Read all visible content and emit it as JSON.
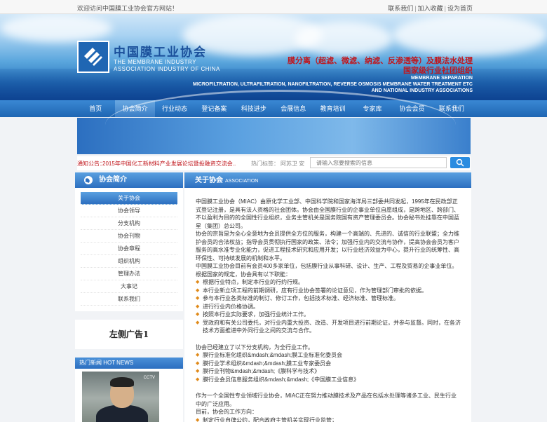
{
  "topbar": {
    "welcome": "欢迎访问中国膜工业协会官方网站！",
    "links": [
      "联系我们",
      "加入收藏",
      "设为首页"
    ]
  },
  "banner": {
    "logo_cn": "中国膜工业协会",
    "logo_en": [
      "THE MEMBRANE INDUSTRY",
      "ASSOCIATION INDUSTRY OF CHINA",
      ""
    ],
    "slogan_cn_1": "膜分离（超滤、微滤、纳滤、反渗透等）及膜法水处理",
    "slogan_cn_2": "国家级行业社团组织",
    "slogan_en_1": "MEMBRANE SEPARATION",
    "slogan_en_2": "MICROFILTRATION, ULTRAFILTRATION, NANOFILTRATION, REVERSE OSMOSIS MEMBRANE WATER TREATMENT ETC",
    "slogan_en_3": "AND NATIONAL INDUSTRY ASSOCIATIONS"
  },
  "nav": {
    "items": [
      "首页",
      "协会简介",
      "行业动态",
      "登记备案",
      "科技进步",
      "会展信息",
      "教育培训",
      "专家库",
      "协会会员",
      "联系我们"
    ],
    "active_index": 1
  },
  "notice": {
    "label": "通知公告：",
    "text": "2015年中国化工新材料产业发展论坛暨投融资交流会...",
    "hot_label": "热门标签：",
    "hot_words": "阿苏卫  安",
    "search_placeholder": "请输入您要搜索的信息"
  },
  "sidebar": {
    "title": "协会简介",
    "items": [
      "关于协会",
      "协会领导",
      "分支机构",
      "协会刊物",
      "协会章程",
      "组织机构",
      "管理办法",
      "大事记",
      "联系我们"
    ],
    "active_index": 0,
    "ad": "左侧广告1",
    "news_title": "热门新闻 HOT NEWS",
    "news_tag": "CCTV"
  },
  "content": {
    "title": "关于协会",
    "subtitle": "ASSOCIATION",
    "p1": "中国膜工业协会（MIAC）由原化学工业部、中国科学院和国家海洋局三部委共同发起，1995年在民政部正式登记注册，是具有法人资格的社会团体。协会由全国膜行业的企事业单位自愿组成，是跨地区、跨部门、不以盈利为目的的全国性行业组织，业务主管机关是国务院国有资产管理委员会。协会秘书处挂靠在中国蓝星（集团）总公司。",
    "p2": "协会的宗旨是为全心全意地为会员提供全方位的服务，构建一个高端的、先进的、诚信的行业联盟；全力维护会员的合法权益；指导会员贯彻执行国家的政策、法令；加强行业内的交流与协作，提高协会会员为客户服务的高水准专业化能力，促进工程技术研究和应用开发；以行业经济效益为中心，提升行业的统筹性、高环保性、可持续发展的机制和水平。",
    "p3": "中国膜工业协会目前有会员400多家单位，包括膜行业从事科研、设计、生产、工程及贸易的企事业单位。根据国家的规定，协会具有以下职能：",
    "bullets1": [
      "根据行业特点，制定本行业的行约行规。",
      "本行业新立项工程的前期调研，应有行业协会签署的论证意见，作为管理部门审批的依据。",
      "参与本行业各类标准的制订、修订工作，包括技术标准、经济标准、管理标准。",
      "进行行业内价格协调。",
      "按照本行业实际要求，加强行业统计工作。",
      "受政府和有关公司委托，对行业内重大投资、改造、开发项目进行前期论证，并参与监督。同时，在各济技术方面推进中外同行业之间的交流与合作。"
    ],
    "p4": "协会已经建立了以下分支机构，为全行业工作。",
    "bullets2": [
      "膜行业标准化组织&mdash;&mdash;膜工业标准化委员会",
      "膜行业学术组织&mdash;&mdash;膜工业专家委员会",
      "膜行业刊物&mdash;&mdash;《膜科学与技术》",
      "膜行业会员信息服务组织&mdash;&mdash;《中国膜工业信息》"
    ],
    "p5": "作为一个全国性专业领域行业协会，MIAC正在努力推动膜技术及产品在包括水处理等诸多工业、民生行业中的广泛应用。",
    "p6": "目前，协会的工作方向：",
    "bullets3": [
      "制定行业自律公约，配合政府主管机关实现行业监管；"
    ]
  }
}
